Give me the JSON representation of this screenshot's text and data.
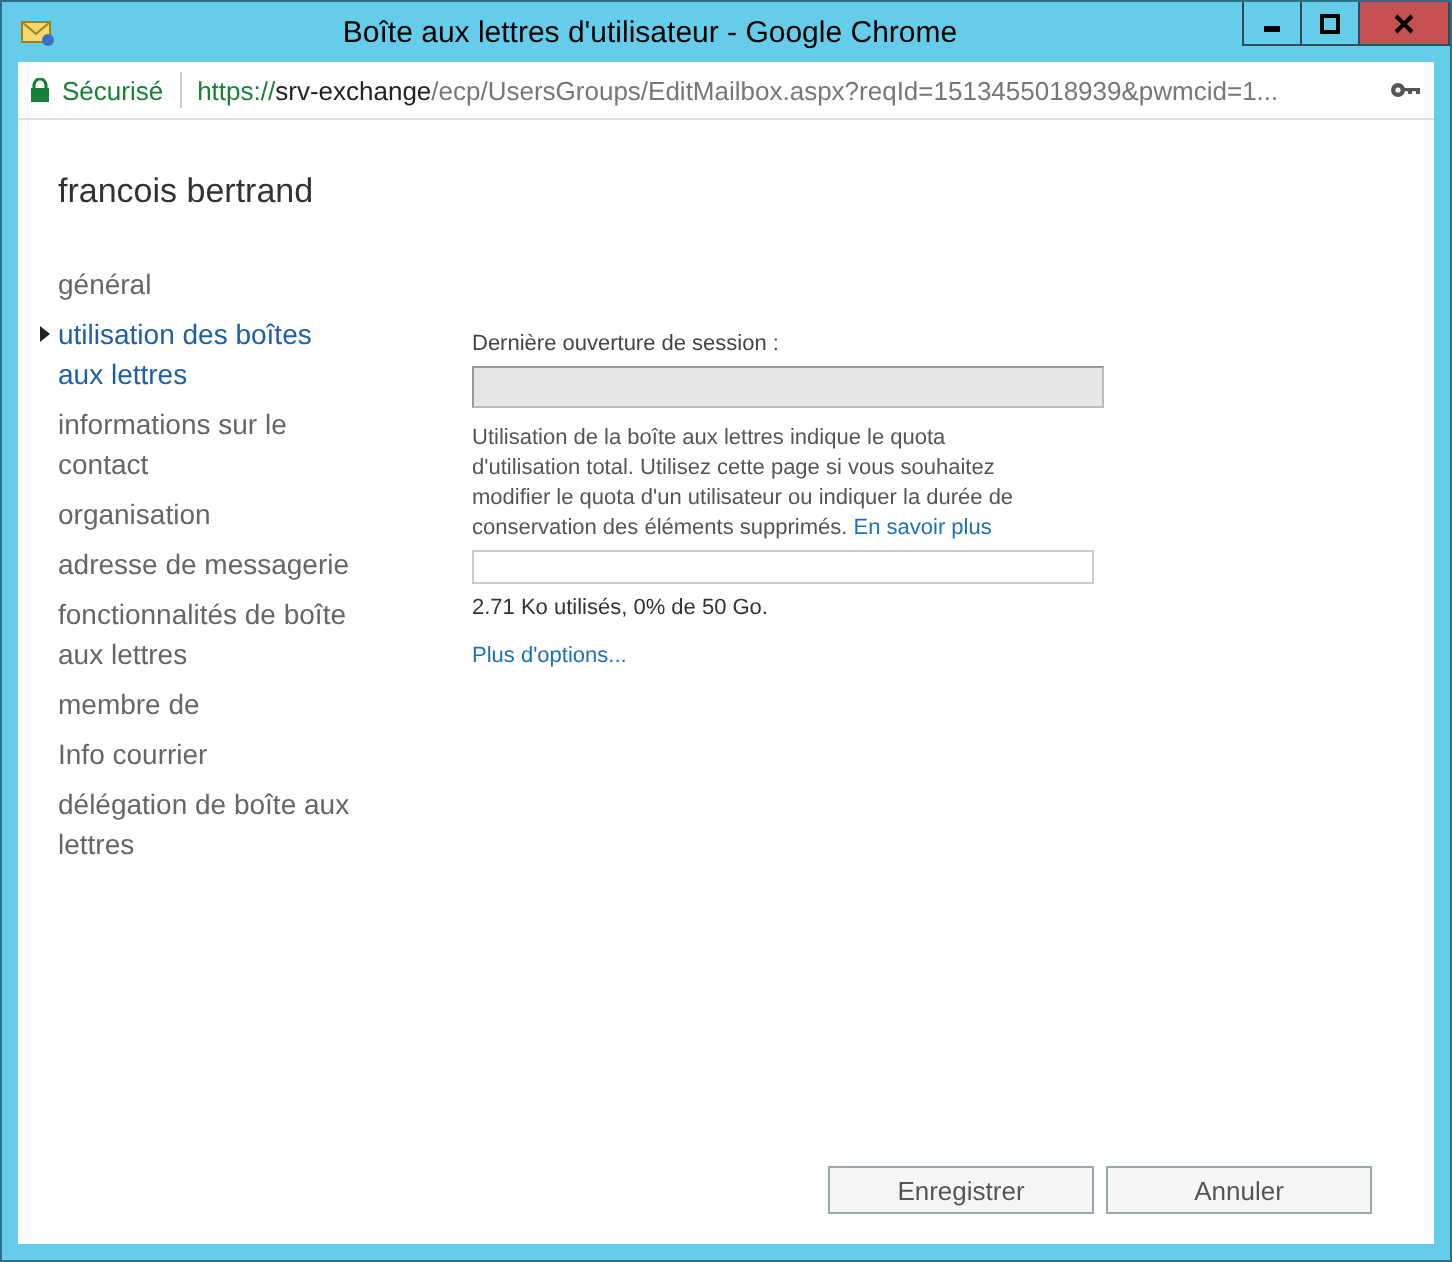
{
  "window": {
    "title": "Boîte aux lettres d'utilisateur - Google Chrome"
  },
  "address_bar": {
    "security": "Sécurisé",
    "url_scheme": "https://",
    "url_host": "srv-exchange",
    "url_path": "/ecp/UsersGroups/EditMailbox.aspx?reqId=1513455018939&pwmcid=1..."
  },
  "page_title": "francois bertrand",
  "nav": [
    {
      "label": "général",
      "selected": false
    },
    {
      "label": "utilisation des boîtes aux lettres",
      "selected": true
    },
    {
      "label": "informations sur le contact",
      "selected": false
    },
    {
      "label": "organisation",
      "selected": false
    },
    {
      "label": "adresse de messagerie",
      "selected": false
    },
    {
      "label": "fonctionnalités de boîte aux lettres",
      "selected": false
    },
    {
      "label": "membre de",
      "selected": false
    },
    {
      "label": "Info courrier",
      "selected": false
    },
    {
      "label": "délégation de boîte aux lettres",
      "selected": false
    }
  ],
  "last_logon": {
    "label": "Dernière ouverture de session :",
    "disabled": true
  },
  "description": "Utilisation de la boîte aux lettres indique le quota d'utilisation total. Utilisez cette page si vous souhaitez modifier le quota d'un utilisateur ou indiquer la durée de conservation des éléments supprimés.",
  "learn_more_link": "En savoir plus",
  "usage": {
    "level": 0,
    "reading": "2.71 Ko utilisés, 0% de 50 Go."
  },
  "more_options_link": "Plus d'options...",
  "buttons": [
    "Enregistrer",
    "Annuler"
  ]
}
